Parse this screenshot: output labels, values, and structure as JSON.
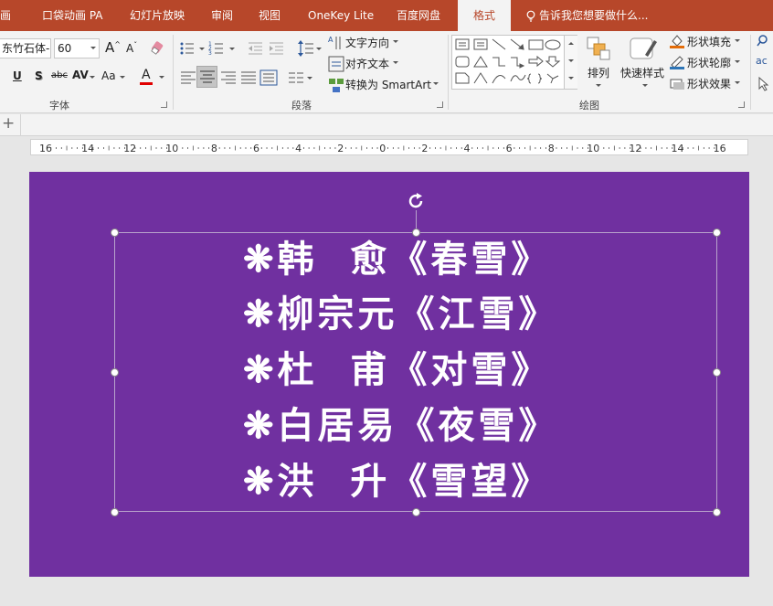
{
  "tabs": [
    {
      "label": "画"
    },
    {
      "label": "口袋动画 PA"
    },
    {
      "label": "幻灯片放映"
    },
    {
      "label": "审阅"
    },
    {
      "label": "视图"
    },
    {
      "label": "OneKey Lite"
    },
    {
      "label": "百度网盘"
    },
    {
      "label": "格式",
      "active": true
    }
  ],
  "tell_me": "告诉我您想要做什么...",
  "ribbon": {
    "font": {
      "font_name": "东竹石体-",
      "font_size": "60",
      "group_label": "字体",
      "bold": "U",
      "shadow": "S",
      "strike": "abc",
      "spacing": "AV",
      "case": "Aa",
      "color_letter": "A"
    },
    "paragraph": {
      "group_label": "段落",
      "text_direction": "文字方向",
      "align_text": "对齐文本",
      "smartart": "转换为 SmartArt"
    },
    "drawing": {
      "group_label": "绘图",
      "arrange": "排列",
      "quick_styles": "快速样式",
      "shape_fill": "形状填充",
      "shape_outline": "形状轮廓",
      "shape_effects": "形状效果"
    }
  },
  "ruler_labels": [
    "16",
    "14",
    "12",
    "10",
    "8",
    "6",
    "4",
    "2",
    "0",
    "2",
    "4",
    "6",
    "8",
    "10",
    "12",
    "14",
    "16"
  ],
  "slide": {
    "lines": [
      {
        "marker": "❋",
        "author": "韩  愈",
        "title": "《春雪》"
      },
      {
        "marker": "❋",
        "author": "柳宗元",
        "title": "《江雪》"
      },
      {
        "marker": "❋",
        "author": "杜  甫",
        "title": "《对雪》"
      },
      {
        "marker": "❋",
        "author": "白居易",
        "title": "《夜雪》"
      },
      {
        "marker": "❋",
        "author": "洪  升",
        "title": "《雪望》"
      }
    ],
    "background": "#7030a0"
  },
  "colors": {
    "accent": "#b7472a",
    "ribbon_bg": "#f3f3f3",
    "font_color_bar": "#e00000"
  }
}
